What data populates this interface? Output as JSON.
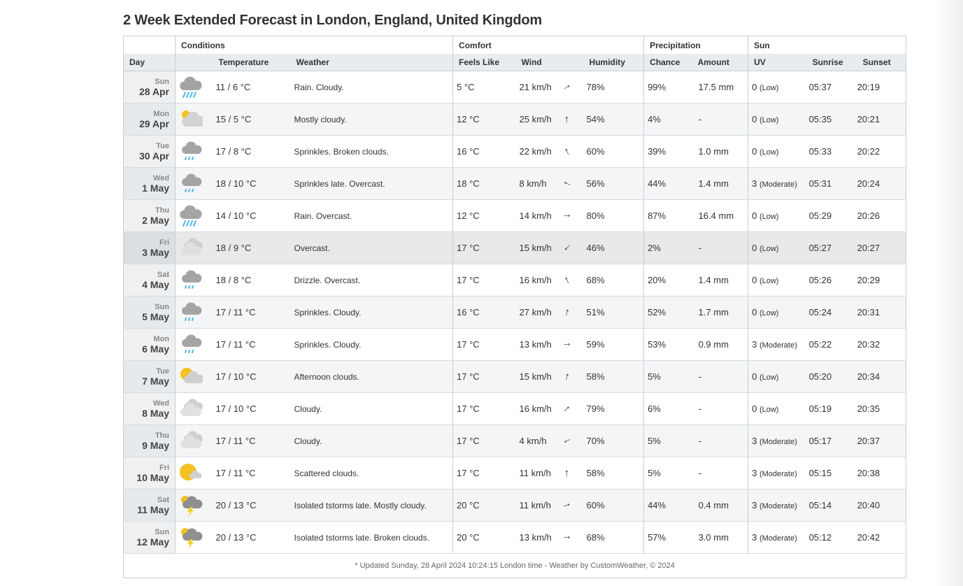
{
  "title": "2 Week Extended Forecast in London, England, United Kingdom",
  "groups": {
    "conditions": "Conditions",
    "comfort": "Comfort",
    "precipitation": "Precipitation",
    "sun": "Sun"
  },
  "columns": {
    "day": "Day",
    "temperature": "Temperature",
    "weather": "Weather",
    "feels_like": "Feels Like",
    "wind": "Wind",
    "humidity": "Humidity",
    "chance": "Chance",
    "amount": "Amount",
    "uv": "UV",
    "sunrise": "Sunrise",
    "sunset": "Sunset"
  },
  "rows": [
    {
      "dow": "Sun",
      "date": "28 Apr",
      "icon": "rain-icon",
      "temp": "11 / 6 °C",
      "weather": "Rain. Cloudy.",
      "feels": "5 °C",
      "wind": "21 km/h",
      "wind_dir_deg": 60,
      "humidity": "78%",
      "chance": "99%",
      "amount": "17.5 mm",
      "uv": "0",
      "uv_level": "(Low)",
      "sunrise": "05:37",
      "sunset": "20:19"
    },
    {
      "dow": "Mon",
      "date": "29 Apr",
      "icon": "mostly-cloudy-icon",
      "temp": "15 / 5 °C",
      "weather": "Mostly cloudy.",
      "feels": "12 °C",
      "wind": "25 km/h",
      "wind_dir_deg": 0,
      "humidity": "54%",
      "chance": "4%",
      "amount": "-",
      "uv": "0",
      "uv_level": "(Low)",
      "sunrise": "05:35",
      "sunset": "20:21"
    },
    {
      "dow": "Tue",
      "date": "30 Apr",
      "icon": "sprinkles-icon",
      "temp": "17 / 8 °C",
      "weather": "Sprinkles. Broken clouds.",
      "feels": "16 °C",
      "wind": "22 km/h",
      "wind_dir_deg": -25,
      "humidity": "60%",
      "chance": "39%",
      "amount": "1.0 mm",
      "uv": "0",
      "uv_level": "(Low)",
      "sunrise": "05:33",
      "sunset": "20:22"
    },
    {
      "dow": "Wed",
      "date": "1 May",
      "icon": "sprinkles-icon",
      "temp": "18 / 10 °C",
      "weather": "Sprinkles late. Overcast.",
      "feels": "18 °C",
      "wind": "8 km/h",
      "wind_dir_deg": -65,
      "humidity": "56%",
      "chance": "44%",
      "amount": "1.4 mm",
      "uv": "3",
      "uv_level": "(Moderate)",
      "sunrise": "05:31",
      "sunset": "20:24"
    },
    {
      "dow": "Thu",
      "date": "2 May",
      "icon": "rain-icon",
      "temp": "14 / 10 °C",
      "weather": "Rain. Overcast.",
      "feels": "12 °C",
      "wind": "14 km/h",
      "wind_dir_deg": 90,
      "humidity": "80%",
      "chance": "87%",
      "amount": "16.4 mm",
      "uv": "0",
      "uv_level": "(Low)",
      "sunrise": "05:29",
      "sunset": "20:26"
    },
    {
      "dow": "Fri",
      "date": "3 May",
      "icon": "overcast-icon",
      "temp": "18 / 9 °C",
      "weather": "Overcast.",
      "feels": "17 °C",
      "wind": "15 km/h",
      "wind_dir_deg": 225,
      "humidity": "46%",
      "chance": "2%",
      "amount": "-",
      "uv": "0",
      "uv_level": "(Low)",
      "sunrise": "05:27",
      "sunset": "20:27"
    },
    {
      "dow": "Sat",
      "date": "4 May",
      "icon": "sprinkles-icon",
      "temp": "18 / 8 °C",
      "weather": "Drizzle. Overcast.",
      "feels": "17 °C",
      "wind": "16 km/h",
      "wind_dir_deg": -25,
      "humidity": "68%",
      "chance": "20%",
      "amount": "1.4 mm",
      "uv": "0",
      "uv_level": "(Low)",
      "sunrise": "05:26",
      "sunset": "20:29"
    },
    {
      "dow": "Sun",
      "date": "5 May",
      "icon": "sprinkles-icon",
      "temp": "17 / 11 °C",
      "weather": "Sprinkles. Cloudy.",
      "feels": "16 °C",
      "wind": "27 km/h",
      "wind_dir_deg": 15,
      "humidity": "51%",
      "chance": "52%",
      "amount": "1.7 mm",
      "uv": "0",
      "uv_level": "(Low)",
      "sunrise": "05:24",
      "sunset": "20:31"
    },
    {
      "dow": "Mon",
      "date": "6 May",
      "icon": "sprinkles-icon",
      "temp": "17 / 11 °C",
      "weather": "Sprinkles. Cloudy.",
      "feels": "17 °C",
      "wind": "13 km/h",
      "wind_dir_deg": 90,
      "humidity": "59%",
      "chance": "53%",
      "amount": "0.9 mm",
      "uv": "3",
      "uv_level": "(Moderate)",
      "sunrise": "05:22",
      "sunset": "20:32"
    },
    {
      "dow": "Tue",
      "date": "7 May",
      "icon": "partly-cloudy-icon",
      "temp": "17 / 10 °C",
      "weather": "Afternoon clouds.",
      "feels": "17 °C",
      "wind": "15 km/h",
      "wind_dir_deg": 15,
      "humidity": "58%",
      "chance": "5%",
      "amount": "-",
      "uv": "0",
      "uv_level": "(Low)",
      "sunrise": "05:20",
      "sunset": "20:34"
    },
    {
      "dow": "Wed",
      "date": "8 May",
      "icon": "cloudy-icon",
      "temp": "17 / 10 °C",
      "weather": "Cloudy.",
      "feels": "17 °C",
      "wind": "16 km/h",
      "wind_dir_deg": 45,
      "humidity": "79%",
      "chance": "6%",
      "amount": "-",
      "uv": "0",
      "uv_level": "(Low)",
      "sunrise": "05:19",
      "sunset": "20:35"
    },
    {
      "dow": "Thu",
      "date": "9 May",
      "icon": "cloudy-icon",
      "temp": "17 / 11 °C",
      "weather": "Cloudy.",
      "feels": "17 °C",
      "wind": "4 km/h",
      "wind_dir_deg": 245,
      "humidity": "70%",
      "chance": "5%",
      "amount": "-",
      "uv": "3",
      "uv_level": "(Moderate)",
      "sunrise": "05:17",
      "sunset": "20:37"
    },
    {
      "dow": "Fri",
      "date": "10 May",
      "icon": "scattered-clouds-icon",
      "temp": "17 / 11 °C",
      "weather": "Scattered clouds.",
      "feels": "17 °C",
      "wind": "11 km/h",
      "wind_dir_deg": 0,
      "humidity": "58%",
      "chance": "5%",
      "amount": "-",
      "uv": "3",
      "uv_level": "(Moderate)",
      "sunrise": "05:15",
      "sunset": "20:38"
    },
    {
      "dow": "Sat",
      "date": "11 May",
      "icon": "thunderstorm-icon",
      "temp": "20 / 13 °C",
      "weather": "Isolated tstorms late. Mostly cloudy.",
      "feels": "20 °C",
      "wind": "11 km/h",
      "wind_dir_deg": 70,
      "humidity": "60%",
      "chance": "44%",
      "amount": "0.4 mm",
      "uv": "3",
      "uv_level": "(Moderate)",
      "sunrise": "05:14",
      "sunset": "20:40"
    },
    {
      "dow": "Sun",
      "date": "12 May",
      "icon": "thunderstorm-icon",
      "temp": "20 / 13 °C",
      "weather": "Isolated tstorms late. Broken clouds.",
      "feels": "20 °C",
      "wind": "13 km/h",
      "wind_dir_deg": 90,
      "humidity": "68%",
      "chance": "57%",
      "amount": "3.0 mm",
      "uv": "3",
      "uv_level": "(Moderate)",
      "sunrise": "05:12",
      "sunset": "20:42"
    }
  ],
  "footer": "* Updated Sunday, 28 April 2024 10:24:15 London time - Weather by CustomWeather, © 2024",
  "colors": {
    "header_bg": "#e9ecef",
    "day_bg": "#eef0f2",
    "border": "#c9ced3",
    "rain": "#4fb6e3",
    "sun": "#f4c024",
    "bolt": "#f0cf1e",
    "cloud": "#a0a0a0"
  }
}
